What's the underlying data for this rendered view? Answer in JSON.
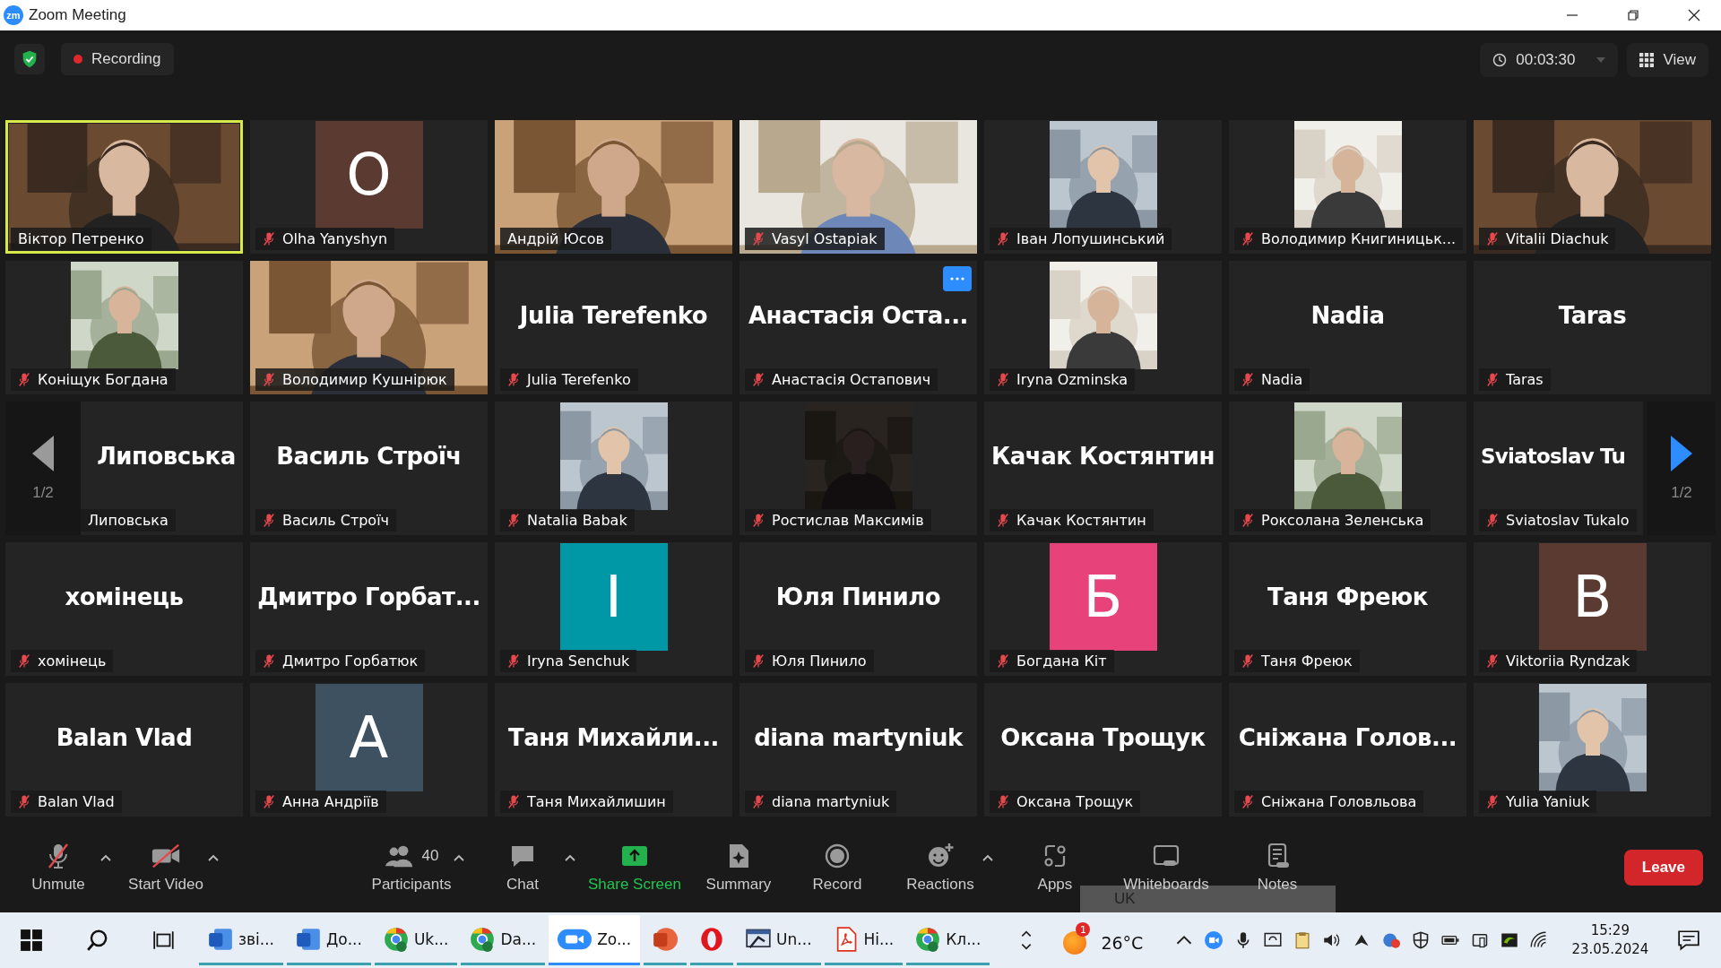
{
  "window": {
    "logo": "zm",
    "title": "Zoom Meeting"
  },
  "top_bar": {
    "recording": "Recording",
    "timer": "00:03:30",
    "view": "View"
  },
  "tiles": [
    {
      "kind": "video",
      "name": "Віктор Петренко",
      "muted": false,
      "speaking": true,
      "menu": false
    },
    {
      "kind": "letter",
      "letter": "O",
      "color": "#5b3a32",
      "name": "Olha Yanyshyn",
      "muted": true,
      "speaking": false,
      "menu": false
    },
    {
      "kind": "video",
      "name": "Андрій Юсов",
      "muted": false,
      "speaking": false,
      "menu": false
    },
    {
      "kind": "video",
      "name": "Vasyl Ostapiak",
      "muted": true,
      "speaking": false,
      "menu": false
    },
    {
      "name": "Іван Лопушинський",
      "muted": true,
      "speaking": false,
      "menu": false
    },
    {
      "name": "Володимир Книгиницьк...",
      "muted": true,
      "speaking": false,
      "menu": false
    },
    {
      "kind": "video",
      "name": "Vitalii Diachuk",
      "muted": true,
      "speaking": false,
      "menu": false
    },
    {
      "name": "Коніщук Богдана",
      "muted": true,
      "speaking": false,
      "menu": false
    },
    {
      "kind": "video",
      "name": "Володимир Кушнірюк",
      "muted": true,
      "speaking": false,
      "menu": false
    },
    {
      "kind": "name",
      "title": "Julia Terefenko",
      "name": "Julia Terefenko",
      "muted": true,
      "speaking": false,
      "menu": false
    },
    {
      "kind": "name",
      "title": "Анастасія  Оста...",
      "name": "Анастасія Остапович",
      "muted": true,
      "speaking": false,
      "menu": true
    },
    {
      "name": "Iryna Ozminska",
      "muted": true,
      "speaking": false,
      "menu": false
    },
    {
      "kind": "name",
      "title": "Nadia",
      "name": "Nadia",
      "muted": true,
      "speaking": false,
      "menu": false
    },
    {
      "kind": "name",
      "title": "Taras",
      "name": "Taras",
      "muted": true,
      "speaking": false,
      "menu": false
    },
    {
      "kind": "name",
      "title": "Липовська",
      "name": "Липовська",
      "muted": false,
      "speaking": false,
      "menu": false
    },
    {
      "kind": "name",
      "title": "Василь Строїч",
      "name": "Василь Строїч",
      "muted": true,
      "speaking": false,
      "menu": false
    },
    {
      "name": "Natalia Babak",
      "muted": true,
      "speaking": false,
      "menu": false
    },
    {
      "name": "Ростислав Максимів",
      "muted": true,
      "speaking": false,
      "menu": false
    },
    {
      "kind": "name",
      "title": "Качак Костянтин",
      "name": "Качак Костянтин",
      "muted": true,
      "speaking": false,
      "menu": false
    },
    {
      "name": "Роксолана Зеленська",
      "muted": true,
      "speaking": false,
      "menu": false
    },
    {
      "kind": "name",
      "title": "Sviatoslav Tu",
      "name": "Sviatoslav Tukalo",
      "muted": true,
      "speaking": false,
      "menu": false
    },
    {
      "kind": "name",
      "title": "хомінець",
      "name": "хомінець",
      "muted": true,
      "speaking": false,
      "menu": false
    },
    {
      "kind": "name",
      "title": "Дмитро  Горбат...",
      "name": "Дмитро Горбатюк",
      "muted": true,
      "speaking": false,
      "menu": false
    },
    {
      "kind": "letter",
      "letter": "I",
      "color": "#0097a7",
      "name": "Iryna Senchuk",
      "muted": true,
      "speaking": false,
      "menu": false
    },
    {
      "kind": "name",
      "title": "Юля Пинило",
      "name": "Юля Пинило",
      "muted": true,
      "speaking": false,
      "menu": false
    },
    {
      "kind": "letter",
      "letter": "Б",
      "color": "#e8427a",
      "name": "Богдана Кіт",
      "muted": true,
      "speaking": false,
      "menu": false
    },
    {
      "kind": "name",
      "title": "Таня Фреюк",
      "name": "Таня Фреюк",
      "muted": true,
      "speaking": false,
      "menu": false
    },
    {
      "kind": "letter",
      "letter": "B",
      "color": "#5b3a32",
      "name": "Viktoriia Ryndzak",
      "muted": true,
      "speaking": false,
      "menu": false
    },
    {
      "kind": "name",
      "title": "Balan Vlad",
      "name": "Balan Vlad",
      "muted": true,
      "speaking": false,
      "menu": false
    },
    {
      "kind": "letter",
      "letter": "A",
      "color": "#3d5160",
      "name": "Анна Андріїв",
      "muted": true,
      "speaking": false,
      "menu": false
    },
    {
      "kind": "name",
      "title": "Таня  Михайли...",
      "name": "Таня Михайлишин",
      "muted": true,
      "speaking": false,
      "menu": false
    },
    {
      "kind": "name",
      "title": "diana martyniuk",
      "name": "diana martyniuk",
      "muted": true,
      "speaking": false,
      "menu": false
    },
    {
      "kind": "name",
      "title": "Оксана Трощук",
      "name": "Оксана Трощук",
      "muted": true,
      "speaking": false,
      "menu": false
    },
    {
      "kind": "name",
      "title": "Сніжана  Голов...",
      "name": "Сніжана Головльова",
      "muted": true,
      "speaking": false,
      "menu": false
    },
    {
      "name": "Yulia Yaniuk",
      "muted": true,
      "speaking": false,
      "menu": false
    }
  ],
  "page_nav": {
    "left": "1/2",
    "right": "1/2"
  },
  "toolbar": {
    "items": [
      {
        "kind": "unmute",
        "label": "Unmute",
        "caret": true
      },
      {
        "kind": "video",
        "label": "Start Video",
        "caret": true
      },
      {
        "kind": "participants",
        "label": "Participants",
        "count": "40",
        "caret": true
      },
      {
        "kind": "chat",
        "label": "Chat",
        "caret": true
      },
      {
        "kind": "share",
        "label": "Share Screen",
        "caret": false
      },
      {
        "kind": "summary",
        "label": "Summary",
        "caret": false
      },
      {
        "kind": "record",
        "label": "Record",
        "caret": false
      },
      {
        "kind": "reactions",
        "label": "Reactions",
        "caret": true
      },
      {
        "kind": "apps",
        "label": "Apps",
        "caret": false
      },
      {
        "kind": "whiteboards",
        "label": "Whiteboards",
        "caret": false
      },
      {
        "kind": "notes",
        "label": "Notes",
        "caret": false
      }
    ],
    "language_bar": "UK",
    "leave": "Leave"
  },
  "taskbar": {
    "apps": [
      {
        "kind": "word",
        "label": "зві...",
        "selected": false
      },
      {
        "kind": "word",
        "label": "До...",
        "selected": false
      },
      {
        "kind": "chrome",
        "label": "Uk...",
        "selected": false
      },
      {
        "kind": "chrome",
        "label": "Da...",
        "selected": false
      },
      {
        "kind": "zoom",
        "label": "Zo...",
        "selected": true
      },
      {
        "kind": "powerpoint",
        "selected": false
      },
      {
        "kind": "opera",
        "selected": false
      },
      {
        "kind": "window",
        "label": "Un...",
        "selected": false
      },
      {
        "kind": "pdf",
        "label": "Hi...",
        "selected": false
      },
      {
        "kind": "chrome",
        "label": "Кл...",
        "selected": false
      }
    ],
    "weather_badge": "1",
    "temperature": "26°C",
    "time": "15:29",
    "date": "23.05.2024"
  }
}
